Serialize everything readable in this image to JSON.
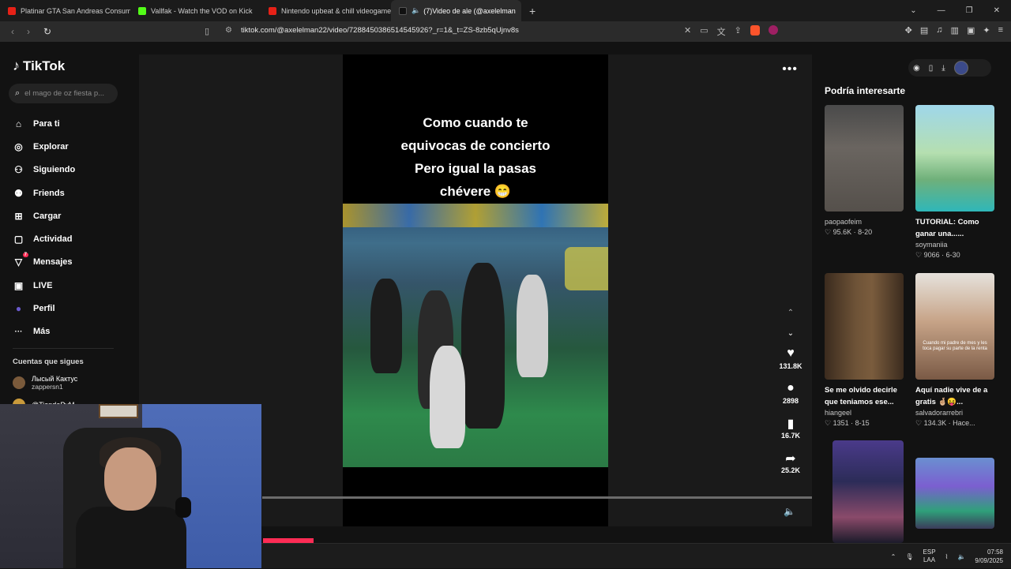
{
  "browser": {
    "tabs": [
      {
        "label": "Platinar GTA San Andreas Consumió",
        "fav_color": "#e62117",
        "active": false
      },
      {
        "label": "Vallfak - Watch the VOD on Kick",
        "fav_color": "#53fc18",
        "active": false
      },
      {
        "label": "Nintendo upbeat & chill videogame",
        "fav_color": "#e62117",
        "active": false
      },
      {
        "label": "(7)Video de ale (@axelelman",
        "fav_color": "#111111",
        "active": true
      }
    ],
    "new_tab": "+",
    "url": "tiktok.com/@axelelman22/video/7288450386514545926?_r=1&_t=ZS-8zb5qUjnv8s"
  },
  "sidebar": {
    "logo": "TikTok",
    "search_placeholder": "el mago de oz fiesta p...",
    "nav": [
      {
        "label": "Para ti",
        "icon": "home-icon",
        "glyph": "⌂"
      },
      {
        "label": "Explorar",
        "icon": "compass-icon",
        "glyph": "◎"
      },
      {
        "label": "Siguiendo",
        "icon": "following-icon",
        "glyph": "⚇"
      },
      {
        "label": "Friends",
        "icon": "friends-icon",
        "glyph": "⚉"
      },
      {
        "label": "Cargar",
        "icon": "upload-icon",
        "glyph": "⊞"
      },
      {
        "label": "Actividad",
        "icon": "activity-icon",
        "glyph": "▢"
      },
      {
        "label": "Mensajes",
        "icon": "messages-icon",
        "glyph": "▽",
        "badge": "7"
      },
      {
        "label": "LIVE",
        "icon": "live-icon",
        "glyph": "▣"
      },
      {
        "label": "Perfil",
        "icon": "profile-icon",
        "glyph": "●"
      },
      {
        "label": "Más",
        "icon": "more-icon",
        "glyph": "···"
      }
    ],
    "following_title": "Cuentas que sigues",
    "following": [
      {
        "name": "Лысый Кактус",
        "handle": "zappersn1"
      },
      {
        "name": "@TiendaPyM",
        "handle": ""
      }
    ]
  },
  "video": {
    "caption_lines": [
      "Como cuando te",
      "equivocas de concierto",
      "Pero igual la pasas",
      "chévere 😁"
    ],
    "likes": "131.8K",
    "comments": "2898",
    "saves": "16.7K",
    "shares": "25.2K"
  },
  "suggestions": {
    "title": "Podría interesarte",
    "cards": [
      {
        "title": "",
        "author": "paopaofeim",
        "stats": "♡ 95.6K · 8-20"
      },
      {
        "title": "TUTORIAL: Como ganar una......",
        "author": "soymaniia",
        "stats": "♡ 9066 · 6-30"
      },
      {
        "title": "Se me olvido decirle que teniamos ese...",
        "author": "hiangeel",
        "stats": "♡ 1351 · 8-15"
      },
      {
        "title": "Aquí nadie vive de a gratis 🤞🏼😝...",
        "author": "salvadorarrebri",
        "stats": "♡ 134.3K · Hace..."
      },
      {
        "title": "",
        "author": "",
        "stats": ""
      },
      {
        "title": "",
        "author": "",
        "stats": ""
      }
    ],
    "thumb_text_1": "Cuando mi padre de mes y les toca pagar su parte de la renta"
  },
  "taskbar": {
    "lang_top": "ESP",
    "lang_bottom": "LAA",
    "time": "07:58",
    "date": "9/09/2025"
  }
}
